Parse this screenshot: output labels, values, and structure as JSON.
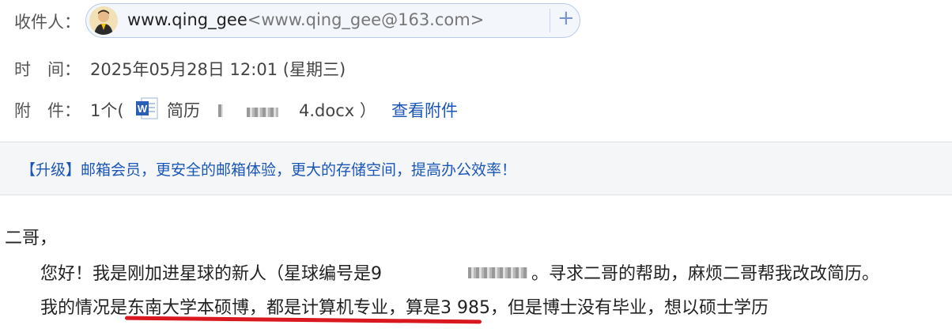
{
  "recipient": {
    "label": "收件人：",
    "name": "www.qing_gee",
    "email": "<www.qing_gee@163.com>",
    "add_icon": "plus-icon"
  },
  "time": {
    "label": "时　间：",
    "value": "2025年05月28日 12:01 (星期三)"
  },
  "attachment": {
    "label": "附　件：",
    "count": "1个(",
    "file_prefix": "简历",
    "file_suffix": "4.docx ）",
    "view_link": "查看附件",
    "icon": "word-doc-icon"
  },
  "banner": {
    "text": "【升级】邮箱会员，更安全的邮箱体验，更大的存储空间，提高办公效率！"
  },
  "body": {
    "greeting": "二哥，",
    "line1a": "您好！我是刚加进星球的新人（星球编号是9",
    "line1b": "。寻求二哥的帮助，麻烦二哥帮我改改简历。",
    "line2": "我的情况是东南大学本硕博，都是计算机专业，算是3 985，但是博士没有毕业，想以硕士学历"
  },
  "colors": {
    "link": "#1a56b8",
    "underline": "#d91820",
    "banner_bg": "#f5f6f8"
  }
}
